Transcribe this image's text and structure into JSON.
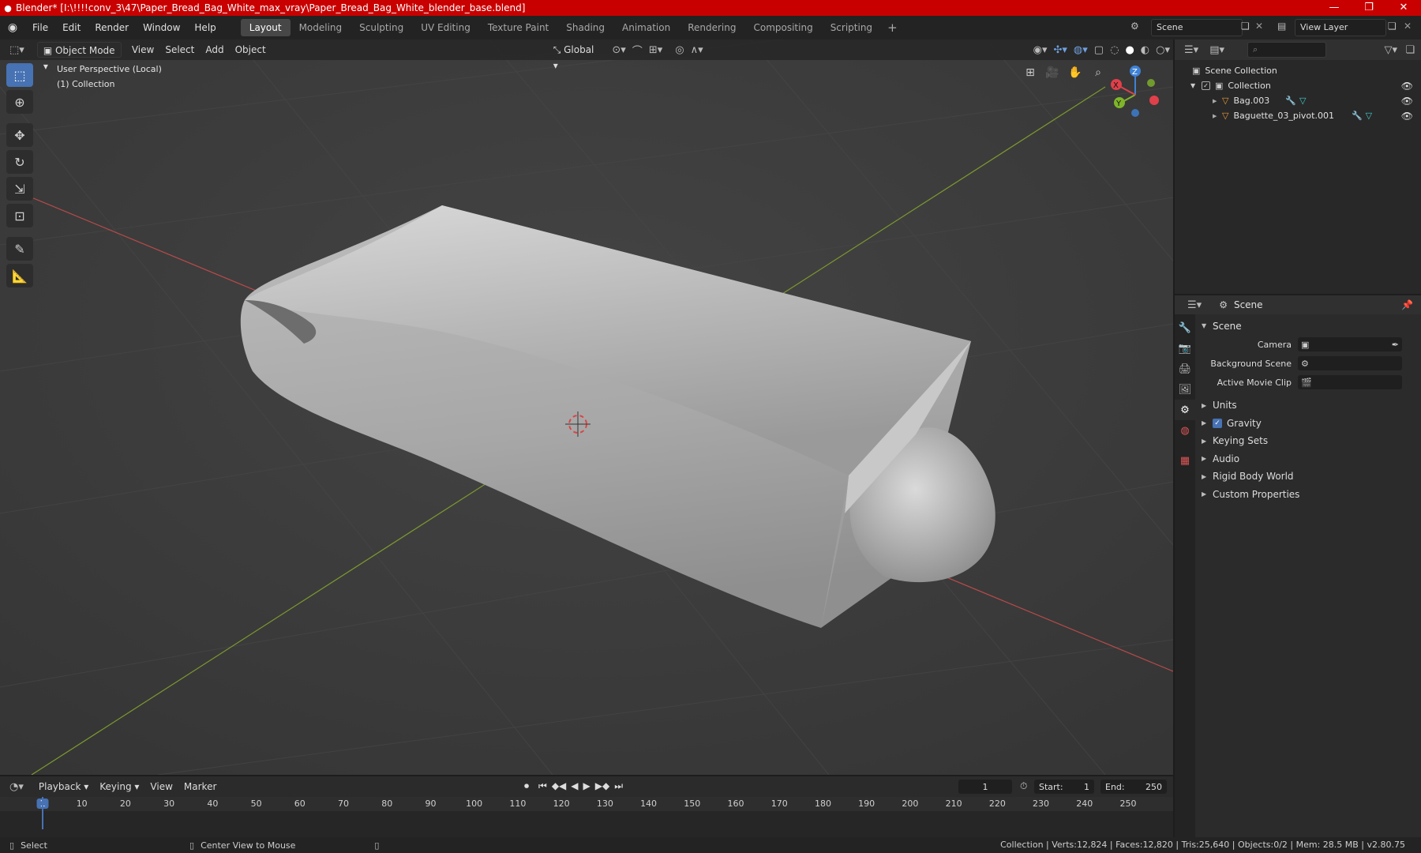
{
  "window": {
    "title": "Blender* [I:\\!!!!conv_3\\47\\Paper_Bread_Bag_White_max_vray\\Paper_Bread_Bag_White_blender_base.blend]",
    "minimize": "—",
    "maximize": "❐",
    "close": "✕"
  },
  "menu": [
    "File",
    "Edit",
    "Render",
    "Window",
    "Help"
  ],
  "workspaces": [
    "Layout",
    "Modeling",
    "Sculpting",
    "UV Editing",
    "Texture Paint",
    "Shading",
    "Animation",
    "Rendering",
    "Compositing",
    "Scripting"
  ],
  "active_workspace": "Layout",
  "scene_name": "Scene",
  "view_layer": "View Layer",
  "viewport": {
    "mode": "Object Mode",
    "menus": [
      "View",
      "Select",
      "Add",
      "Object"
    ],
    "transform_orientation": "Global",
    "info_line1": "User Perspective (Local)",
    "info_line2": "(1) Collection",
    "gizmo": {
      "z": "Z",
      "y": "Y",
      "x": "X"
    }
  },
  "outliner": {
    "search_placeholder": "",
    "root": "Scene Collection",
    "collection": "Collection",
    "objects": [
      "Bag.003",
      "Baguette_03_pivot.001"
    ]
  },
  "properties": {
    "context": "Scene",
    "panel": "Scene",
    "camera_label": "Camera",
    "background_label": "Background Scene",
    "movieclip_label": "Active Movie Clip",
    "subpanels": [
      "Units",
      "Gravity",
      "Keying Sets",
      "Audio",
      "Rigid Body World",
      "Custom Properties"
    ]
  },
  "timeline": {
    "menus": [
      "Playback",
      "Keying",
      "View",
      "Marker"
    ],
    "current_frame": "1",
    "start_label": "Start:",
    "start": "1",
    "end_label": "End:",
    "end": "250",
    "ticks": [
      "1",
      "10",
      "20",
      "30",
      "40",
      "50",
      "60",
      "70",
      "80",
      "90",
      "100",
      "110",
      "120",
      "130",
      "140",
      "150",
      "160",
      "170",
      "180",
      "190",
      "200",
      "210",
      "220",
      "230",
      "240",
      "250"
    ]
  },
  "status": {
    "left_action": "Select",
    "middle_action": "Center View to Mouse",
    "stats": "Collection | Verts:12,824 | Faces:12,820 | Tris:25,640 | Objects:0/2 | Mem: 28.5 MB | v2.80.75"
  },
  "colors": {
    "titlebar": "#c90000",
    "accent": "#4772b3",
    "axis_x": "#e0404a",
    "axis_y": "#7fb52a",
    "axis_z": "#3f82d6"
  }
}
